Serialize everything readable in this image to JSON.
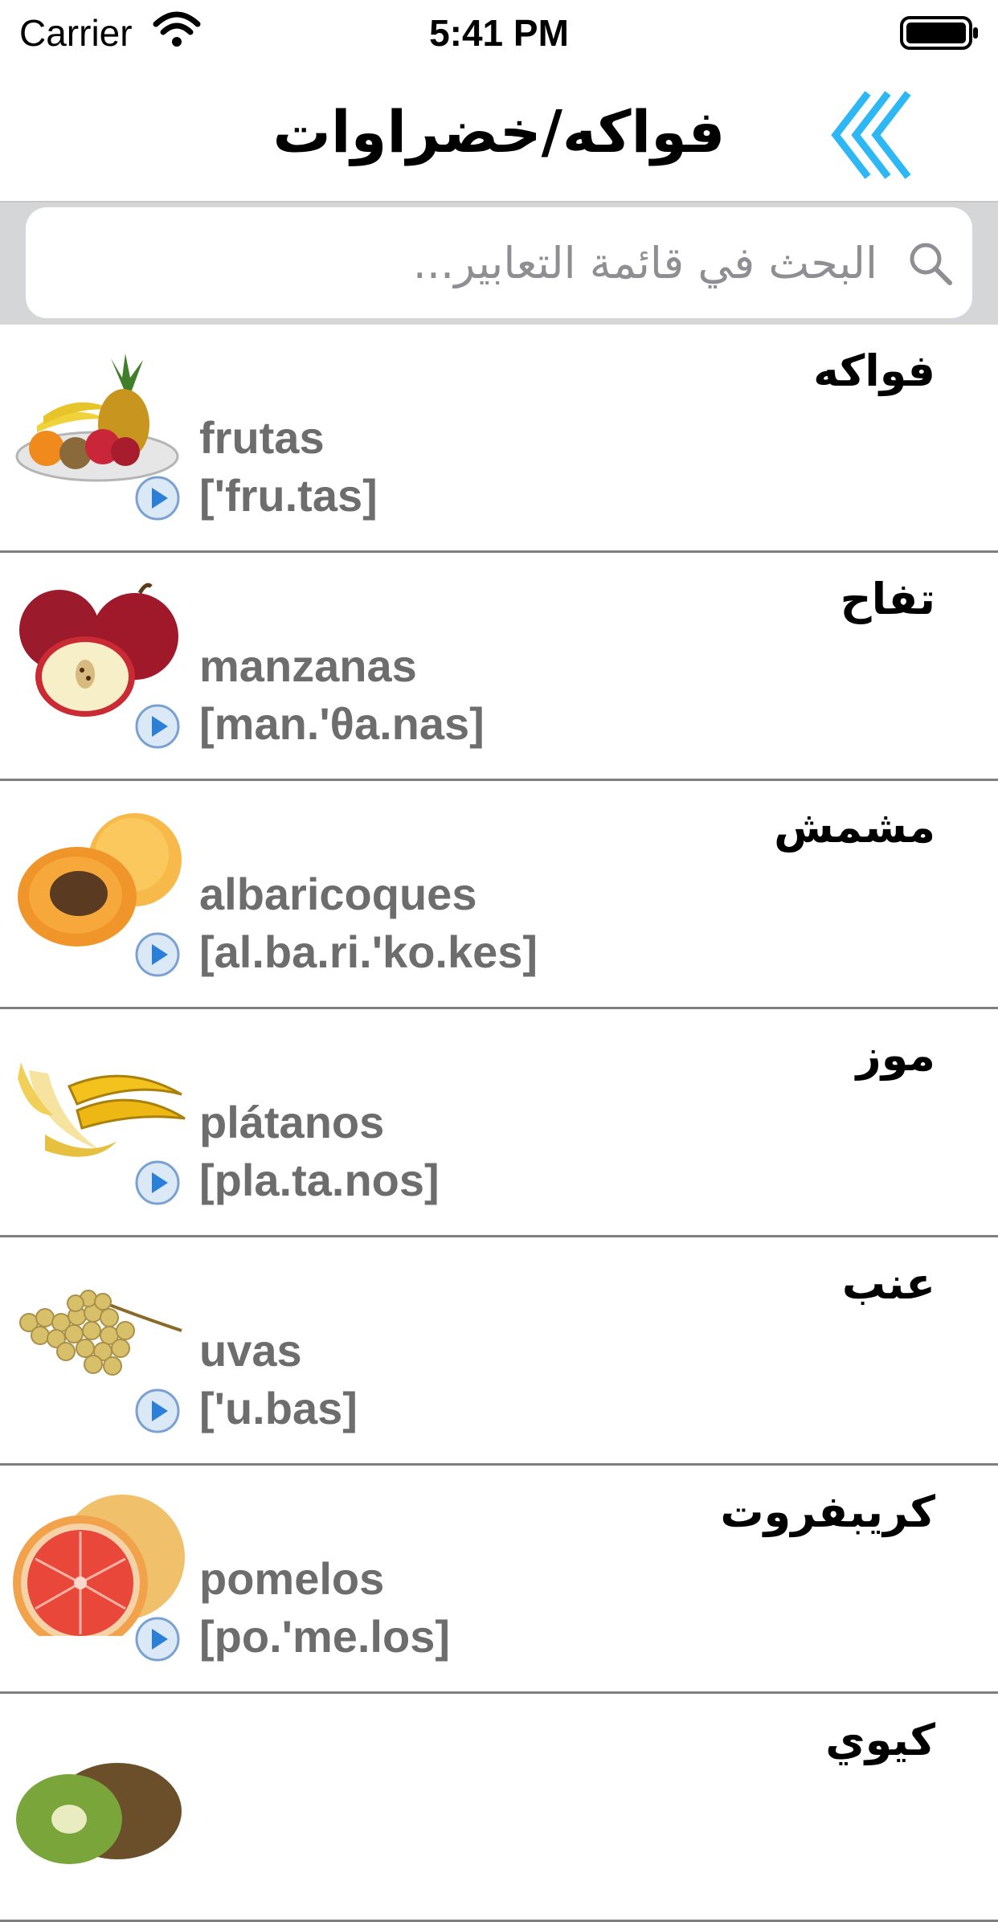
{
  "status": {
    "carrier": "Carrier",
    "time": "5:41 PM"
  },
  "nav": {
    "title": "فواكه/خضراوات"
  },
  "search": {
    "placeholder": "البحث في قائمة التعابير..."
  },
  "items": [
    {
      "arabic": "فواكه",
      "spanish": "frutas",
      "ipa": "['fru.tas]",
      "image": "fruit-plate-icon"
    },
    {
      "arabic": "تفاح",
      "spanish": "manzanas",
      "ipa": "[man.'θa.nas]",
      "image": "apples-icon"
    },
    {
      "arabic": "مشمش",
      "spanish": "albaricoques",
      "ipa": "[al.ba.ri.'ko.kes]",
      "image": "apricots-icon"
    },
    {
      "arabic": "موز",
      "spanish": "plátanos",
      "ipa": "[pla.ta.nos]",
      "image": "bananas-icon"
    },
    {
      "arabic": "عنب",
      "spanish": "uvas",
      "ipa": "['u.bas]",
      "image": "grapes-icon"
    },
    {
      "arabic": "كريبفروت",
      "spanish": "pomelos",
      "ipa": "[po.'me.los]",
      "image": "grapefruit-icon"
    },
    {
      "arabic": "كيوي",
      "spanish": "",
      "ipa": "",
      "image": "kiwi-icon"
    }
  ],
  "colors": {
    "accent": "#2db8f5",
    "secondary_text": "#6d6d6d",
    "separator": "#7f7f7f",
    "search_bg": "#d5d6d8"
  }
}
